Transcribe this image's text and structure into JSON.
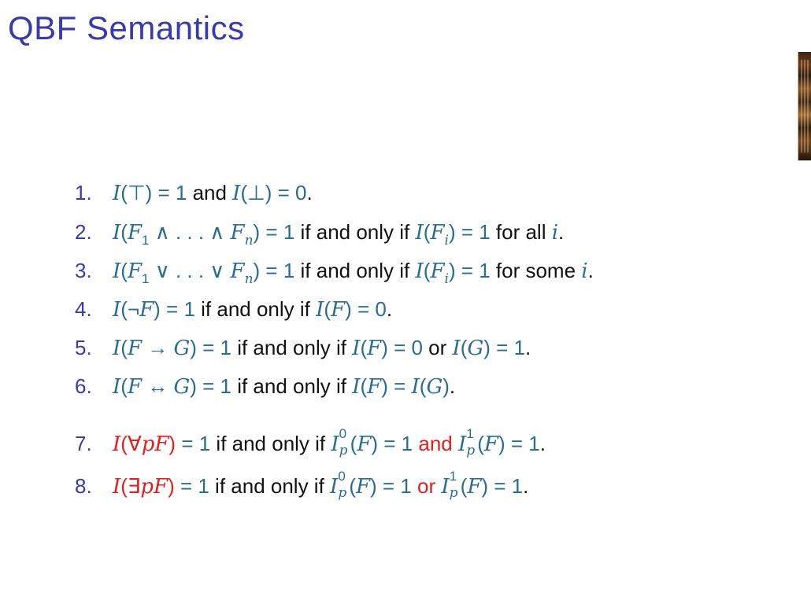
{
  "slide": {
    "title": "QBF Semantics"
  },
  "items": [
    {
      "num": "1.",
      "text": "I(⊤) = 1 and I(⊥) = 0."
    },
    {
      "num": "2.",
      "text": "I(F1 ∧ . . . ∧ Fn) = 1 if and only if I(Fi) = 1 for all i."
    },
    {
      "num": "3.",
      "text": "I(F1 ∨ . . . ∨ Fn) = 1 if and only if I(Fi) = 1 for some i."
    },
    {
      "num": "4.",
      "text": "I(¬F) = 1 if and only if I(F) = 0."
    },
    {
      "num": "5.",
      "text": "I(F → G) = 1 if and only if I(F) = 0 or I(G) = 1."
    },
    {
      "num": "6.",
      "text": "I(F ↔ G) = 1 if and only if I(F) = I(G)."
    },
    {
      "num": "7.",
      "text": "I(∀pF) = 1 if and only if I0p(F) = 1 and I1p(F) = 1."
    },
    {
      "num": "8.",
      "text": "I(∃pF) = 1 if and only if I0p(F) = 1 or I1p(F) = 1."
    }
  ],
  "colors": {
    "title": "#3a3aa8",
    "math": "#2b6d8f",
    "highlight": "#e02020",
    "text": "#111111"
  }
}
